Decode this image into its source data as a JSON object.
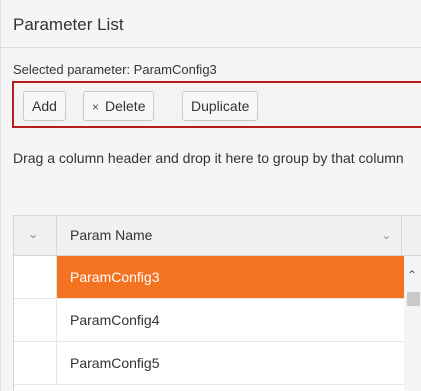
{
  "panel": {
    "title": "Parameter List",
    "selected_label": "Selected parameter: ParamConfig3"
  },
  "toolbar": {
    "add_label": "Add",
    "delete_icon": "×",
    "delete_label": "Delete",
    "duplicate_label": "Duplicate"
  },
  "grid": {
    "group_hint": "Drag a column header and drop it here to group by that column",
    "header": {
      "expand_icon": "chevron-down-icon",
      "name_label": "Param Name",
      "name_menu_icon": "chevron-down-icon"
    },
    "rows": [
      {
        "name": "ParamConfig3",
        "selected": true
      },
      {
        "name": "ParamConfig4",
        "selected": false
      },
      {
        "name": "ParamConfig5",
        "selected": false
      }
    ]
  },
  "colors": {
    "selection": "#f47321",
    "focus_outline": "#b71c1c"
  }
}
